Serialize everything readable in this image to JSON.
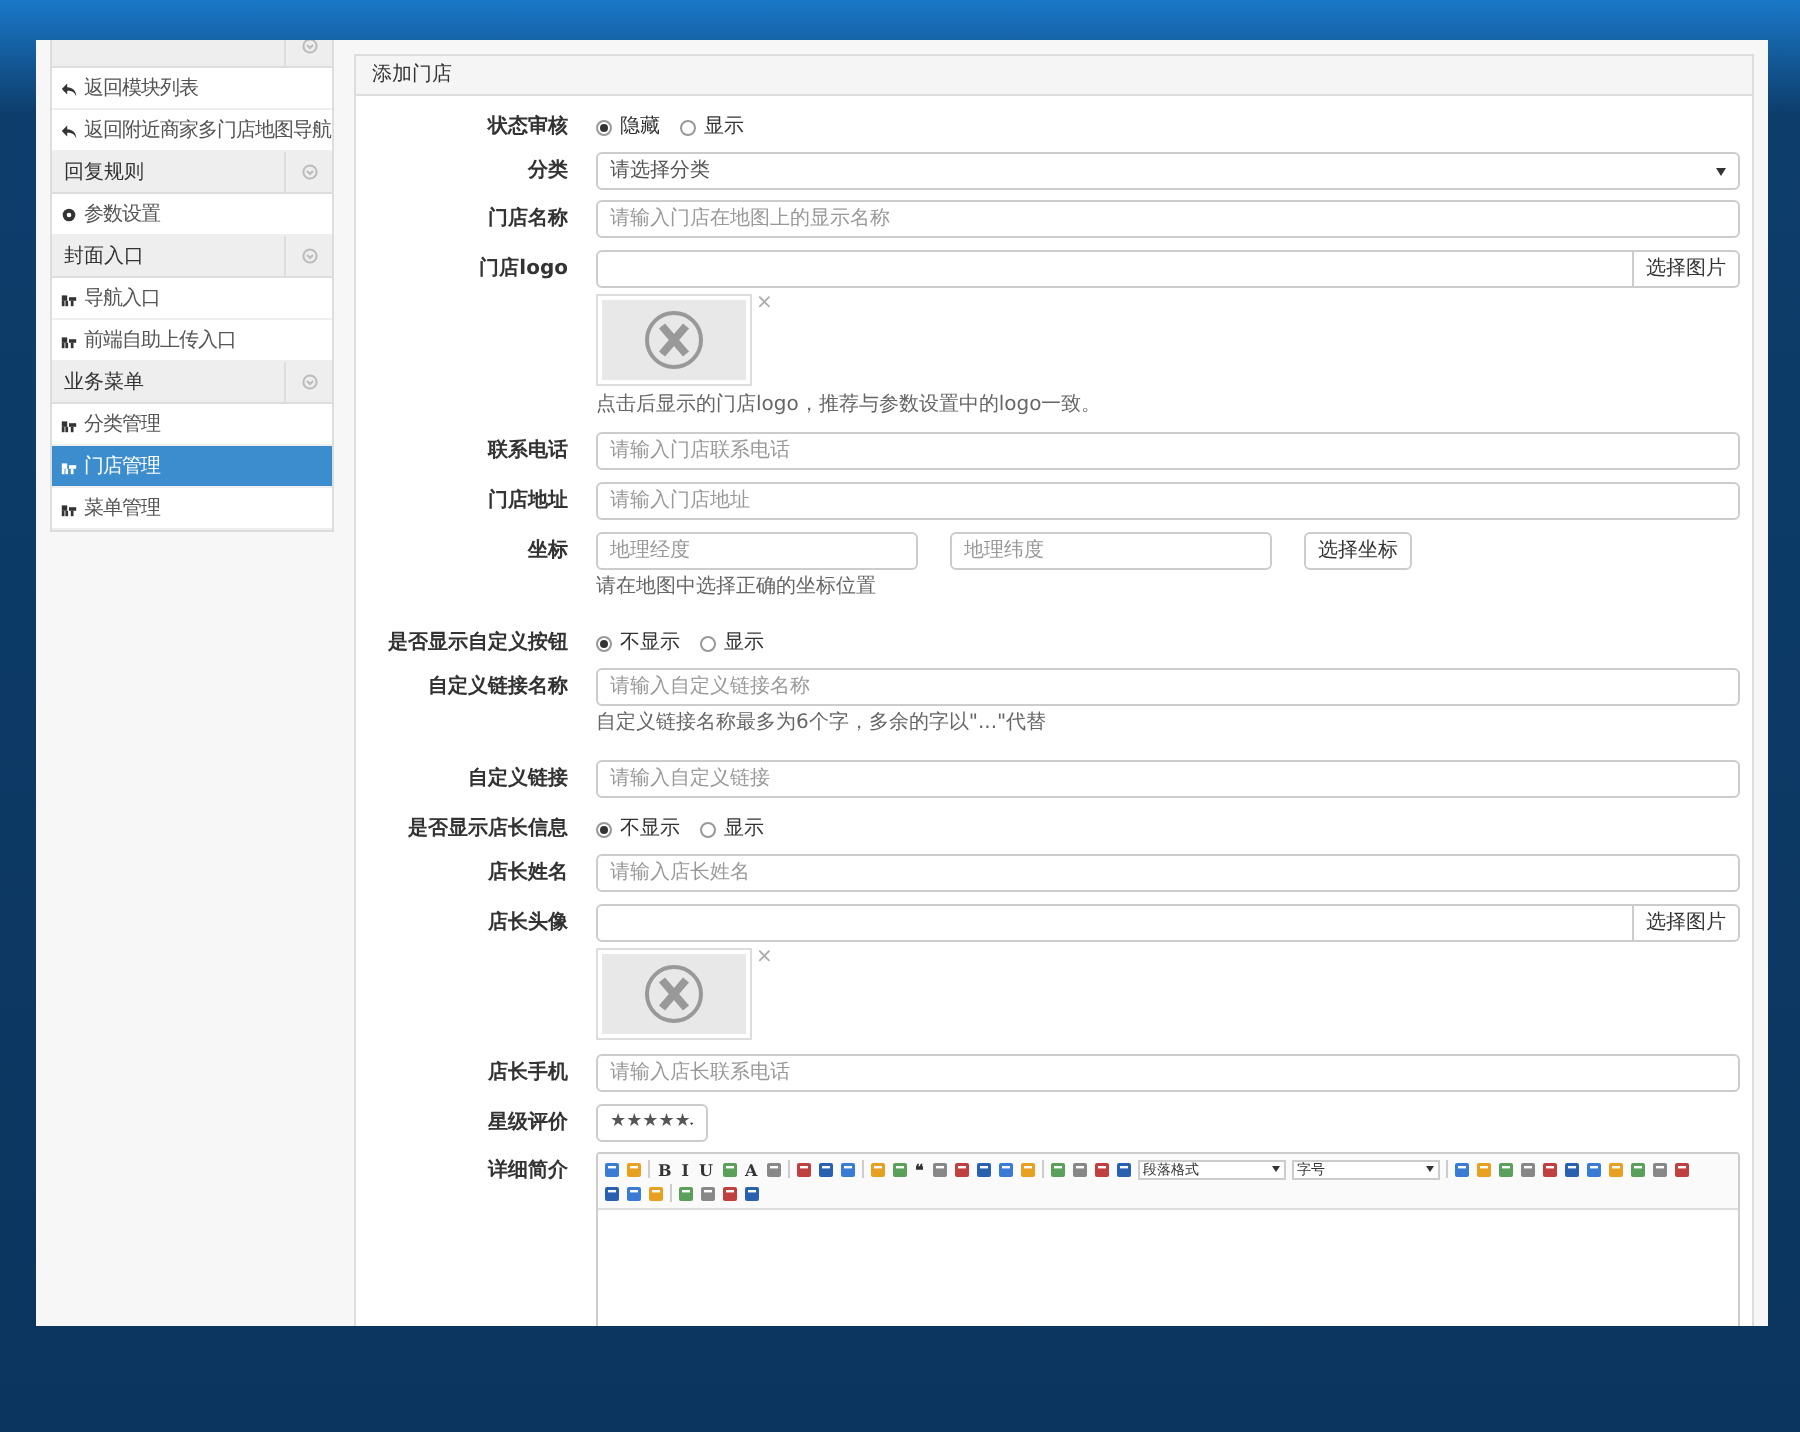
{
  "sidebar": [
    {
      "items": [
        {
          "label": "返回模块列表",
          "kind": "back",
          "selected": false
        },
        {
          "label": "返回附近商家多门店地图导航",
          "kind": "back",
          "selected": false
        }
      ]
    },
    {
      "title": "回复规则",
      "items": [
        {
          "label": "参数设置",
          "kind": "settings",
          "selected": false
        }
      ]
    },
    {
      "title": "封面入口",
      "items": [
        {
          "label": "导航入口",
          "kind": "entry",
          "selected": false
        },
        {
          "label": "前端自助上传入口",
          "kind": "entry",
          "selected": false
        }
      ]
    },
    {
      "title": "业务菜单",
      "items": [
        {
          "label": "分类管理",
          "kind": "entry",
          "selected": false
        },
        {
          "label": "门店管理",
          "kind": "entry",
          "selected": true
        },
        {
          "label": "菜单管理",
          "kind": "entry",
          "selected": false
        }
      ]
    }
  ],
  "panel": {
    "title": "添加门店",
    "fields": [
      {
        "kind": "radio",
        "label": "状态审核",
        "options": [
          {
            "label": "隐藏",
            "selected": true
          },
          {
            "label": "显示",
            "selected": false
          }
        ]
      },
      {
        "kind": "select",
        "label": "分类",
        "value": "请选择分类"
      },
      {
        "kind": "text",
        "label": "门店名称",
        "placeholder": "请输入门店在地图上的显示名称"
      },
      {
        "kind": "image",
        "label": "门店logo",
        "button": "选择图片",
        "remove": "×",
        "help": "点击后显示的门店logo，推荐与参数设置中的logo一致。"
      },
      {
        "kind": "text",
        "label": "联系电话",
        "placeholder": "请输入门店联系电话"
      },
      {
        "kind": "text",
        "label": "门店地址",
        "placeholder": "请输入门店地址"
      },
      {
        "kind": "coords",
        "label": "坐标",
        "placeholders": [
          "地理经度",
          "地理纬度"
        ],
        "button": "选择坐标",
        "help": "请在地图中选择正确的坐标位置"
      },
      {
        "kind": "radio",
        "label": "是否显示自定义按钮",
        "options": [
          {
            "label": "不显示",
            "selected": true
          },
          {
            "label": "显示",
            "selected": false
          }
        ]
      },
      {
        "kind": "text",
        "label": "自定义链接名称",
        "placeholder": "请输入自定义链接名称",
        "help": "自定义链接名称最多为6个字，多余的字以\"...\"代替"
      },
      {
        "kind": "text",
        "label": "自定义链接",
        "placeholder": "请输入自定义链接"
      },
      {
        "kind": "radio",
        "label": "是否显示店长信息",
        "options": [
          {
            "label": "不显示",
            "selected": true
          },
          {
            "label": "显示",
            "selected": false
          }
        ]
      },
      {
        "kind": "text",
        "label": "店长姓名",
        "placeholder": "请输入店长姓名"
      },
      {
        "kind": "image",
        "label": "店长头像",
        "button": "选择图片",
        "remove": "×"
      },
      {
        "kind": "text",
        "label": "店长手机",
        "placeholder": "请输入店长联系电话"
      },
      {
        "kind": "stars",
        "label": "星级评价",
        "value": "★★★★★"
      },
      {
        "kind": "editor",
        "label": "详细简介",
        "toolbar": [
          [
            {
              "kind": "icon"
            },
            {
              "kind": "icon"
            },
            {
              "kind": "sep"
            },
            {
              "kind": "text",
              "label": "B"
            },
            {
              "kind": "text",
              "label": "I"
            },
            {
              "kind": "text",
              "label": "U"
            },
            {
              "kind": "icon"
            },
            {
              "kind": "text",
              "label": "A"
            },
            {
              "kind": "icon"
            },
            {
              "kind": "sep"
            },
            {
              "kind": "icon"
            },
            {
              "kind": "icon"
            },
            {
              "kind": "icon"
            },
            {
              "kind": "sep"
            },
            {
              "kind": "icon"
            },
            {
              "kind": "icon"
            },
            {
              "kind": "text",
              "label": "❝"
            },
            {
              "kind": "icon"
            },
            {
              "kind": "icon"
            },
            {
              "kind": "icon"
            },
            {
              "kind": "icon"
            },
            {
              "kind": "icon"
            },
            {
              "kind": "sep"
            },
            {
              "kind": "icon"
            },
            {
              "kind": "icon"
            },
            {
              "kind": "icon"
            },
            {
              "kind": "icon"
            },
            {
              "kind": "select",
              "label": "段落格式"
            },
            {
              "kind": "select",
              "label": "字号"
            },
            {
              "kind": "sep"
            },
            {
              "kind": "icon"
            },
            {
              "kind": "icon"
            },
            {
              "kind": "icon"
            },
            {
              "kind": "icon"
            },
            {
              "kind": "icon"
            },
            {
              "kind": "icon"
            },
            {
              "kind": "icon"
            },
            {
              "kind": "icon"
            },
            {
              "kind": "icon"
            },
            {
              "kind": "icon"
            },
            {
              "kind": "icon"
            }
          ],
          [
            {
              "kind": "icon"
            },
            {
              "kind": "icon"
            },
            {
              "kind": "icon"
            },
            {
              "kind": "sep"
            },
            {
              "kind": "icon"
            },
            {
              "kind": "icon"
            },
            {
              "kind": "icon"
            },
            {
              "kind": "icon"
            }
          ]
        ]
      }
    ]
  }
}
